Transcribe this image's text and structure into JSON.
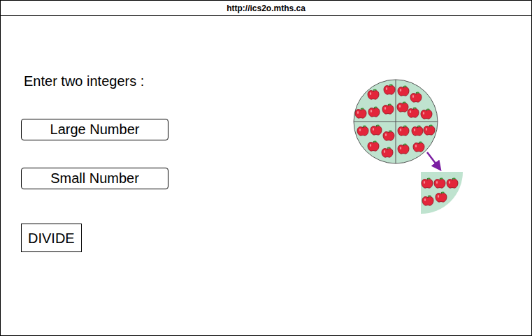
{
  "window": {
    "url": "http://ics2o.mths.ca"
  },
  "prompt": "Enter two integers :",
  "inputs": [
    {
      "placeholder": "Large Number"
    },
    {
      "placeholder": "Small Number"
    }
  ],
  "button": "DIVIDE"
}
